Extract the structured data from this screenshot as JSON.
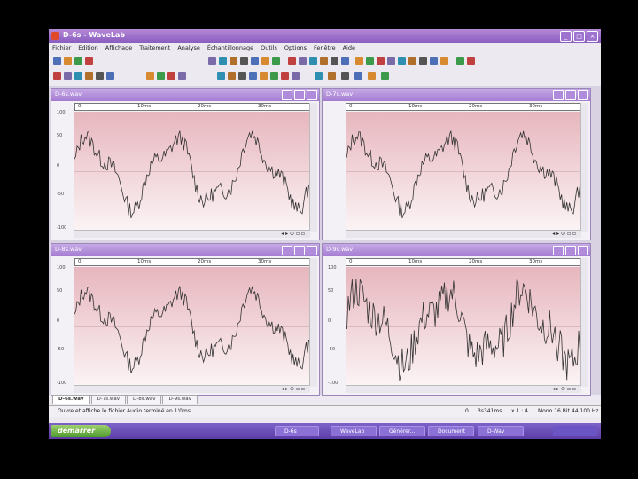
{
  "window": {
    "title": "D-6s - WaveLab"
  },
  "menu": [
    "Fichier",
    "Edition",
    "Affichage",
    "Traitement",
    "Analyse",
    "Échantillonnage",
    "Outils",
    "Options",
    "Fenêtre",
    "Aide"
  ],
  "children": [
    {
      "name": "D-6s.wav",
      "ruler": [
        "0",
        "10ms",
        "20ms",
        "30ms"
      ],
      "ylabels": [
        "100",
        "50",
        "0",
        "-50",
        "-100"
      ],
      "series": "a"
    },
    {
      "name": "D-7s.wav",
      "ruler": [
        "0",
        "10ms",
        "20ms",
        "30ms"
      ],
      "ylabels": [],
      "series": "a"
    },
    {
      "name": "D-8s.wav",
      "ruler": [
        "0",
        "10ms",
        "20ms",
        "30ms"
      ],
      "ylabels": [
        "100",
        "50",
        "0",
        "-50",
        "-100"
      ],
      "series": "a"
    },
    {
      "name": "D-9s.wav",
      "ruler": [
        "0",
        "10ms",
        "20ms",
        "30ms"
      ],
      "ylabels": [
        "100",
        "50",
        "0",
        "-50",
        "-100"
      ],
      "series": "b"
    }
  ],
  "tabs": [
    "D-6s.wav",
    "D-7s.wav",
    "D-8s.wav",
    "D-9s.wav"
  ],
  "status": {
    "message": "Ouvre et affiche le fichier Audio terminé en 1'0ms",
    "position": "0",
    "duration": "3s341ms",
    "zoom": "x 1 : 4",
    "format": "Mono 16 Bit",
    "rate": "44 100 Hz"
  },
  "taskbar": {
    "start": "démarrer",
    "buttons": [
      "D-6s",
      "WaveLab",
      "Générer...",
      "Document",
      "D-Wav"
    ],
    "clock": ""
  },
  "colors": {
    "plot_top": "#e7b6be",
    "plot_bottom": "#fbf4f5",
    "wave": "#333333",
    "accent": "#9a6cd0"
  }
}
